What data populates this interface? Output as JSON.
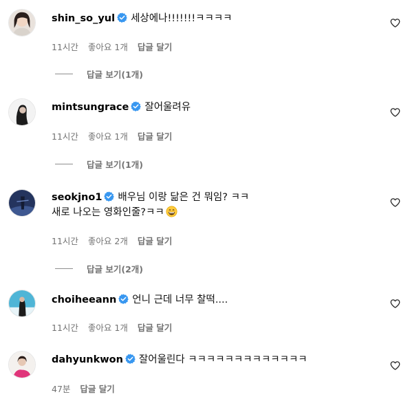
{
  "comments": [
    {
      "username": "shin_so_yul",
      "text": "세상에나!!!!!!!ㅋㅋㅋㅋ",
      "time": "11시간",
      "likes": "좋아요 1개",
      "reply": "답글 달기",
      "view_replies": "답글 보기(1개)"
    },
    {
      "username": "mintsungrace",
      "text": "잘어울려유",
      "time": "11시간",
      "likes": "좋아요 1개",
      "reply": "답글 달기",
      "view_replies": "답글 보기(1개)"
    },
    {
      "username": "seokjno1",
      "text": "배우님 이랑 닮은 건 뭐임? ㅋㅋ",
      "text_line2": "새로 나오는 영화인줄?ㅋㅋ",
      "emoji": "grinning-face-emoji",
      "time": "11시간",
      "likes": "좋아요 2개",
      "reply": "답글 달기",
      "view_replies": "답글 보기(2개)"
    },
    {
      "username": "choiheeann",
      "text": "언니 근데 너무 찰떡....",
      "time": "11시간",
      "likes": "좋아요 1개",
      "reply": "답글 달기"
    },
    {
      "username": "dahyunkwon",
      "text": "잘어울린다 ㅋㅋㅋㅋㅋㅋㅋㅋㅋㅋㅋㅋㅋ",
      "time": "47분",
      "reply": "답글 달기"
    }
  ],
  "colors": {
    "verified": "#3897f0",
    "meta": "#737373"
  },
  "icons": {
    "verified": "verified-badge-icon",
    "like": "heart-icon"
  }
}
